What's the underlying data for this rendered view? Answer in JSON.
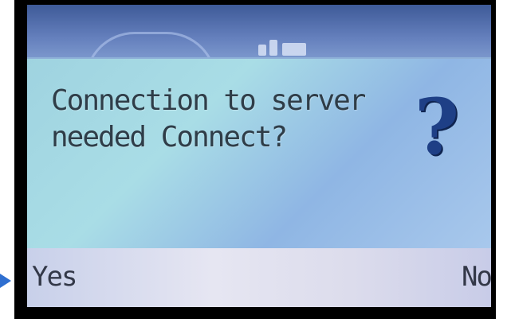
{
  "dialog": {
    "message": "Connection to server\nneeded Connect?",
    "icon": "question-mark-icon"
  },
  "softkeys": {
    "left_label": "Yes",
    "right_label": "No"
  },
  "colors": {
    "dialog_background": "#a0d2e2",
    "softkey_bar": "#e0e0ee",
    "text": "#2f3d48",
    "icon": "#1e3f86",
    "pointer": "#2f6fd0"
  }
}
